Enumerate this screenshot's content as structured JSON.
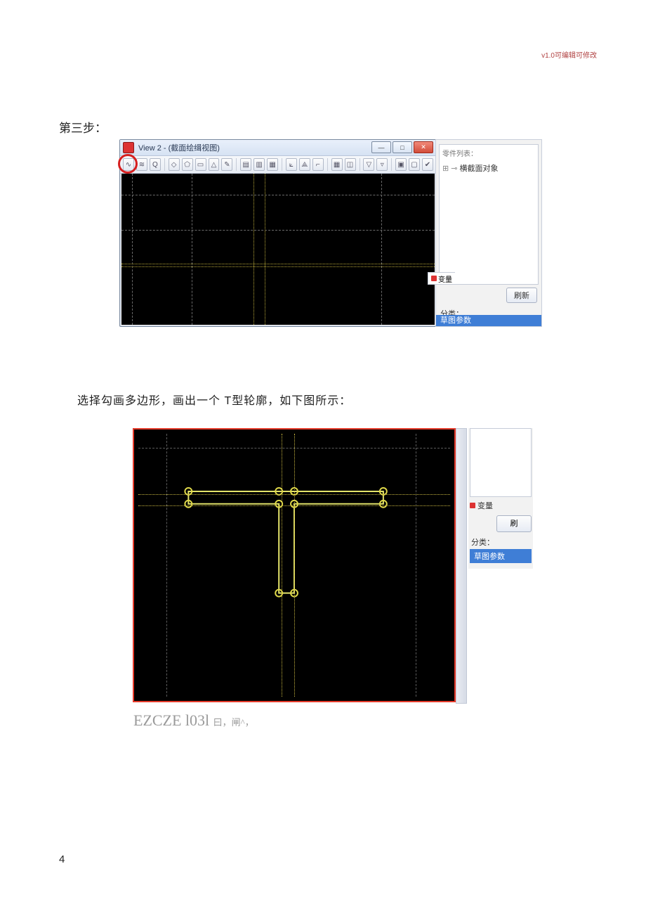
{
  "header_note": "v1.0可编辑可修改",
  "step_title": "第三步：",
  "instruction": "选择勾画多边形，画出一个 T型轮廓，如下图所示：",
  "bottom_caption_main": "EZCZE l03l",
  "bottom_caption_sub": " 曰，闸^，",
  "page_number": "4",
  "fig1": {
    "window_title": "View 2 - (截面绘缉视图)",
    "winbtn_min": "—",
    "winbtn_max": "□",
    "winbtn_close": "✕",
    "toolbar_icons": [
      "∿",
      "≋",
      "Q",
      "",
      "◇",
      "⬠",
      "▭",
      "△",
      "✎",
      "",
      "▤",
      "▥",
      "▦",
      "",
      "⟀",
      "⟁",
      "⌐",
      "",
      "▦",
      "◫",
      "",
      "▽",
      "▿",
      "",
      "▣",
      "▢",
      "✔"
    ],
    "side": {
      "tree_header": "零件列表：",
      "tree_item": "横截面对象",
      "tab_label": "变量",
      "refresh_btn": "刷新",
      "class_label": "分类：",
      "bluebar": "草图参数"
    }
  },
  "fig2": {
    "side": {
      "tab_label": "变量",
      "btn_label": "刷",
      "class_label": "分类：",
      "bluebar": "草图参数"
    }
  }
}
